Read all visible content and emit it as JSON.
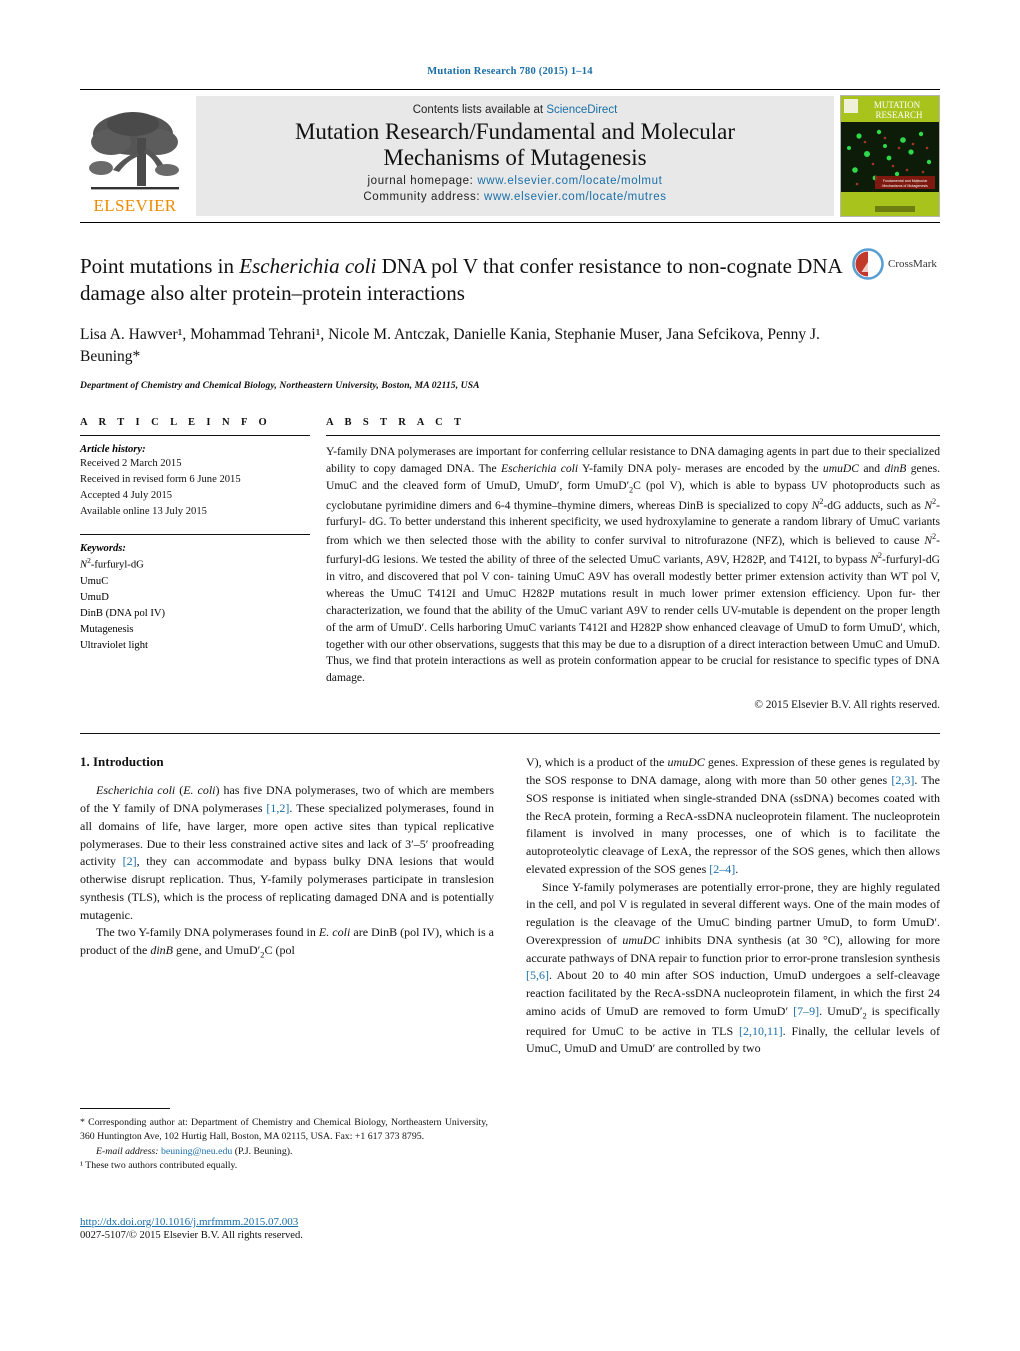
{
  "running_head": "Mutation Research 780 (2015) 1–14",
  "masthead": {
    "publisher_logo_text": "ELSEVIER",
    "contents_prefix": "Contents lists available at ",
    "contents_link": "ScienceDirect",
    "journal_title_line1": "Mutation Research/Fundamental and Molecular",
    "journal_title_line2": "Mechanisms of Mutagenesis",
    "homepage_label": "journal homepage: ",
    "homepage_url": "www.elsevier.com/locate/molmut",
    "community_label": "Community address: ",
    "community_url": "www.elsevier.com/locate/mutres",
    "cover_title_line1": "MUTATION",
    "cover_title_line2": "RESEARCH",
    "cover_subtitle": "Fundamental and Molecular Mechanisms of Mutagenesis"
  },
  "article": {
    "title_part1": "Point mutations in ",
    "title_italic": "Escherichia coli",
    "title_part2": " DNA pol V that confer resistance to non-cognate DNA damage also alter protein–protein interactions",
    "authors": "Lisa A. Hawver¹, Mohammad Tehrani¹, Nicole M. Antczak, Danielle Kania, Stephanie Muser, Jana Sefcikova, Penny J. Beuning*",
    "affiliation": "Department of Chemistry and Chemical Biology, Northeastern University, Boston, MA 02115, USA",
    "crossmark_label": "CrossMark"
  },
  "article_info": {
    "heading": "A R T I C L E   I N F O",
    "history_label": "Article history:",
    "history": [
      "Received 2 March 2015",
      "Received in revised form 6 June 2015",
      "Accepted 4 July 2015",
      "Available online 13 July 2015"
    ],
    "keywords_label": "Keywords:",
    "keywords": [
      "N²-furfuryl-dG",
      "UmuC",
      "UmuD",
      "DinB (DNA pol IV)",
      "Mutagenesis",
      "Ultraviolet light"
    ]
  },
  "abstract": {
    "heading": "A B S T R A C T",
    "paragraph": "Y-family DNA polymerases are important for conferring cellular resistance to DNA damaging agents in part due to their specialized ability to copy damaged DNA. The Escherichia coli Y-family DNA polymerases are encoded by the umuDC and dinB genes. UmuC and the cleaved form of UmuD, UmuD′, form UmuD′2C (pol V), which is able to bypass UV photoproducts such as cyclobutane pyrimidine dimers and 6-4 thymine–thymine dimers, whereas DinB is specialized to copy N2-dG adducts, such as N2-furfuryl-dG. To better understand this inherent specificity, we used hydroxylamine to generate a random library of UmuC variants from which we then selected those with the ability to confer survival to nitrofurazone (NFZ), which is believed to cause N2-furfuryl-dG lesions. We tested the ability of three of the selected UmuC variants, A9V, H282P, and T412I, to bypass N2-furfuryl-dG in vitro, and discovered that pol V containing UmuC A9V has overall modestly better primer extension activity than WT pol V, whereas the UmuC T412I and UmuC H282P mutations result in much lower primer extension efficiency. Upon further characterization, we found that the ability of the UmuC variant A9V to render cells UV-mutable is dependent on the proper length of the arm of UmuD′. Cells harboring UmuC variants T412I and H282P show enhanced cleavage of UmuD to form UmuD′, which, together with our other observations, suggests that this may be due to a disruption of a direct interaction between UmuC and UmuD. Thus, we find that protein interactions as well as protein conformation appear to be crucial for resistance to specific types of DNA damage.",
    "copyright": "© 2015 Elsevier B.V. All rights reserved."
  },
  "body": {
    "section_heading": "1.  Introduction",
    "left_paragraph_1": "Escherichia coli (E. coli) has five DNA polymerases, two of which are members of the Y family of DNA polymerases [1,2]. These specialized polymerases, found in all domains of life, have larger, more open active sites than typical replicative polymerases. Due to their less constrained active sites and lack of 3′–5′ proofreading activity [2], they can accommodate and bypass bulky DNA lesions that would otherwise disrupt replication. Thus, Y-family polymerases participate in translesion synthesis (TLS), which is the process of replicating damaged DNA and is potentially mutagenic.",
    "left_paragraph_2": "The two Y-family DNA polymerases found in E. coli are DinB (pol IV), which is a product of the dinB gene, and UmuD′2C (pol",
    "right_paragraph_1": "V), which is a product of the umuDC genes. Expression of these genes is regulated by the SOS response to DNA damage, along with more than 50 other genes [2,3]. The SOS response is initiated when single-stranded DNA (ssDNA) becomes coated with the RecA protein, forming a RecA-ssDNA nucleoprotein filament. The nucleoprotein filament is involved in many processes, one of which is to facilitate the autoproteolytic cleavage of LexA, the repressor of the SOS genes, which then allows elevated expression of the SOS genes [2–4].",
    "right_paragraph_2": "Since Y-family polymerases are potentially error-prone, they are highly regulated in the cell, and pol V is regulated in several different ways. One of the main modes of regulation is the cleavage of the UmuC binding partner UmuD, to form UmuD′. Overexpression of umuDC inhibits DNA synthesis (at 30 °C), allowing for more accurate pathways of DNA repair to function prior to error-prone translesion synthesis [5,6]. About 20 to 40 min after SOS induction, UmuD undergoes a self-cleavage reaction facilitated by the RecA-ssDNA nucleoprotein filament, in which the first 24 amino acids of UmuD are removed to form UmuD′ [7–9]. UmuD′2 is specifically required for UmuC to be active in TLS [2,10,11]. Finally, the cellular levels of UmuC, UmuD and UmuD′ are controlled by two"
  },
  "footnotes": {
    "corresponding": "*  Corresponding author at: Department of Chemistry and Chemical Biology, Northeastern University, 360 Huntington Ave, 102 Hurtig Hall, Boston, MA 02115, USA. Fax: +1 617 373 8795.",
    "email_label": "E-mail address:",
    "email": "beuning@neu.edu",
    "email_suffix": " (P.J. Beuning).",
    "equal_contrib": "¹  These two authors contributed equally."
  },
  "footer": {
    "doi_url": "http://dx.doi.org/10.1016/j.mrfmmm.2015.07.003",
    "issn_line": "0027-5107/© 2015 Elsevier B.V. All rights reserved."
  },
  "colors": {
    "link": "#1a6fa8",
    "elsevier_orange": "#ED8B00",
    "band_gray": "#e8e8e8"
  }
}
